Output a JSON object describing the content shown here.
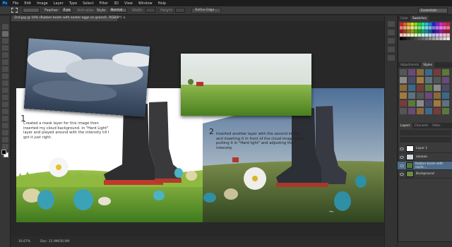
{
  "app": {
    "logo": "Ps"
  },
  "menu": [
    "File",
    "Edit",
    "Image",
    "Layer",
    "Type",
    "Select",
    "Filter",
    "3D",
    "View",
    "Window",
    "Help"
  ],
  "options": {
    "feather_label": "Feather:",
    "feather_value": "0 px",
    "antialias_label": "Anti-alias",
    "style_label": "Style:",
    "style_value": "Normal",
    "width_label": "Width:",
    "height_label": "Height:",
    "refine_label": "Refine Edge...",
    "workspace": "Essentials"
  },
  "document": {
    "tab_title": "2nd.jpg @ 16% (Rubber boots with easter eggs on grass©, RGB/8*) ×",
    "step1_number": "1",
    "note1": "Created a mask layer for this image then inserted my cloud background. in \"Hard Light\" layer and played around with the intensity till I got it just right.",
    "step2_number": "2",
    "note2": "Inserted another layer with the second image and inserting it in front of the cloud image again putting it in \"Hard light\" and adjusting the intensity."
  },
  "status": {
    "zoom": "16.67%",
    "doc": "Doc: 11.9M/30.0M"
  },
  "panels": {
    "color_tabs": [
      "Color",
      "Swatches"
    ],
    "adjust_tabs": [
      "Adjustments",
      "Styles"
    ],
    "layers_tabs": [
      "Layers",
      "Channels",
      "Paths"
    ],
    "layers": [
      {
        "name": "Layer 1",
        "thumb": "#ffffff"
      },
      {
        "name": "aaaaaa",
        "thumb": "#cfd8de"
      },
      {
        "name": "Rubber boots with easte...",
        "thumb": "#5a7a3a"
      },
      {
        "name": "Background",
        "thumb": "#6b8a4a"
      }
    ]
  }
}
